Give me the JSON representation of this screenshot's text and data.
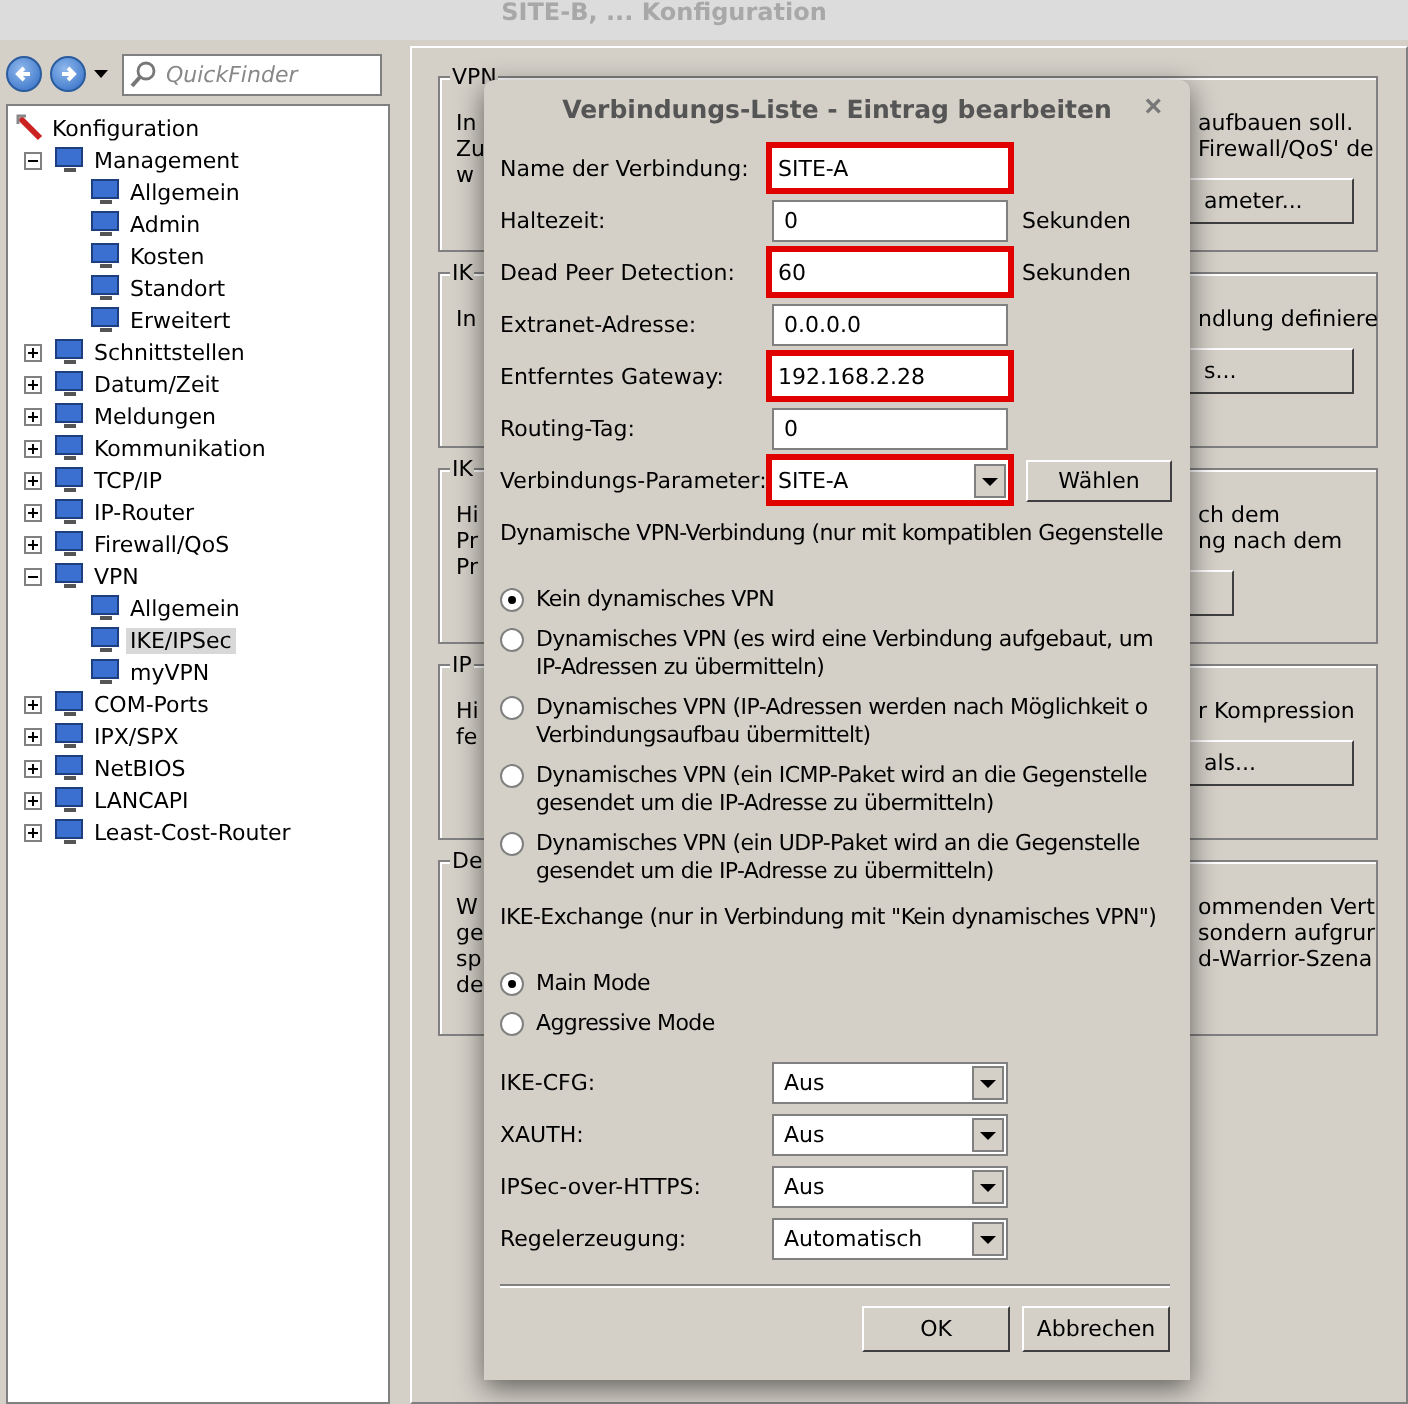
{
  "window": {
    "title": "SITE-B, ... Konfiguration"
  },
  "toolbar": {
    "search": {
      "placeholder": "QuickFinder"
    }
  },
  "tree": {
    "root": "Konfiguration",
    "items": [
      {
        "label": "Management",
        "expanded": true,
        "selected": false,
        "children": [
          {
            "label": "Allgemein",
            "selected": false
          },
          {
            "label": "Admin",
            "selected": false
          },
          {
            "label": "Kosten",
            "selected": false
          },
          {
            "label": "Standort",
            "selected": false
          },
          {
            "label": "Erweitert",
            "selected": false
          }
        ]
      },
      {
        "label": "Schnittstellen",
        "expanded": false,
        "selected": false
      },
      {
        "label": "Datum/Zeit",
        "expanded": false,
        "selected": false
      },
      {
        "label": "Meldungen",
        "expanded": false,
        "selected": false
      },
      {
        "label": "Kommunikation",
        "expanded": false,
        "selected": false
      },
      {
        "label": "TCP/IP",
        "expanded": false,
        "selected": false
      },
      {
        "label": "IP-Router",
        "expanded": false,
        "selected": false
      },
      {
        "label": "Firewall/QoS",
        "expanded": false,
        "selected": false
      },
      {
        "label": "VPN",
        "expanded": true,
        "selected": false,
        "children": [
          {
            "label": "Allgemein",
            "selected": false
          },
          {
            "label": "IKE/IPSec",
            "selected": true
          },
          {
            "label": "myVPN",
            "selected": false
          }
        ]
      },
      {
        "label": "COM-Ports",
        "expanded": false,
        "selected": false
      },
      {
        "label": "IPX/SPX",
        "expanded": false,
        "selected": false
      },
      {
        "label": "NetBIOS",
        "expanded": false,
        "selected": false
      },
      {
        "label": "LANCAPI",
        "expanded": false,
        "selected": false
      },
      {
        "label": "Least-Cost-Router",
        "expanded": false,
        "selected": false
      }
    ]
  },
  "groups": [
    {
      "title": "VPN",
      "left_lines": [
        "In",
        "Zu",
        "w"
      ],
      "right_lines": [
        "aufbauen soll.",
        "Firewall/QoS' de"
      ],
      "button": {
        "kind": "labeled",
        "label": "ameter..."
      }
    },
    {
      "title": "IK",
      "left_lines": [
        "In"
      ],
      "right_lines": [
        "ndlung definiere"
      ],
      "button": {
        "kind": "labeled",
        "label": "s..."
      }
    },
    {
      "title": "IK",
      "left_lines": [
        "Hi",
        "Pr",
        "Pr"
      ],
      "right_lines": [
        "ch dem",
        "ng nach dem"
      ],
      "button": {
        "kind": "blank"
      }
    },
    {
      "title": "IP",
      "left_lines": [
        "Hi",
        "fe"
      ],
      "right_lines": [
        "r Kompression"
      ],
      "button": {
        "kind": "labeled",
        "label": "als..."
      }
    },
    {
      "title": "De",
      "left_lines": [
        "W",
        "ge",
        "sp",
        "de"
      ],
      "right_lines": [
        "ommenden Vert",
        "sondern aufgrur",
        "d-Warrior-Szena"
      ]
    }
  ],
  "dialog": {
    "title": "Verbindungs-Liste - Eintrag bearbeiten",
    "close": "×",
    "fields": [
      {
        "kind": "text",
        "label": "Name der Verbindung:",
        "value": "SITE-A",
        "highlighted": true
      },
      {
        "kind": "text",
        "label": "Haltezeit:",
        "value": "0",
        "unit": "Sekunden",
        "highlighted": false
      },
      {
        "kind": "text",
        "label": "Dead Peer Detection:",
        "value": "60",
        "unit": "Sekunden",
        "highlighted": true
      },
      {
        "kind": "text",
        "label": "Extranet-Adresse:",
        "value": "0.0.0.0",
        "highlighted": false
      },
      {
        "kind": "text",
        "label": "Entferntes Gateway:",
        "value": "192.168.2.28",
        "highlighted": true
      },
      {
        "kind": "text",
        "label": "Routing-Tag:",
        "value": "0",
        "highlighted": false
      },
      {
        "kind": "select",
        "label": "Verbindungs-Parameter:",
        "value": "SITE-A",
        "highlighted": true,
        "button": "Wählen"
      }
    ],
    "dynamic_heading": "Dynamische VPN-Verbindung (nur mit kompatiblen Gegenstelle",
    "dynamic_options": [
      {
        "label": "Kein dynamisches VPN",
        "selected": true
      },
      {
        "label": "Dynamisches VPN (es wird eine Verbindung aufgebaut, um IP-Adressen zu übermitteln)",
        "selected": false
      },
      {
        "label": "Dynamisches VPN (IP-Adressen werden nach Möglichkeit o Verbindungsaufbau übermittelt)",
        "selected": false
      },
      {
        "label": "Dynamisches VPN (ein ICMP-Paket wird an die Gegenstelle gesendet um die IP-Adresse zu übermitteln)",
        "selected": false
      },
      {
        "label": "Dynamisches VPN (ein UDP-Paket wird an die Gegenstelle gesendet um die IP-Adresse zu übermitteln)",
        "selected": false
      }
    ],
    "exchange_heading": "IKE-Exchange (nur in Verbindung mit \"Kein dynamisches VPN\")",
    "exchange_options": [
      {
        "label": "Main Mode",
        "selected": true
      },
      {
        "label": "Aggressive Mode",
        "selected": false
      }
    ],
    "selects": [
      {
        "label": "IKE-CFG:",
        "value": "Aus"
      },
      {
        "label": "XAUTH:",
        "value": "Aus"
      },
      {
        "label": "IPSec-over-HTTPS:",
        "value": "Aus"
      },
      {
        "label": "Regelerzeugung:",
        "value": "Automatisch"
      }
    ],
    "buttons": [
      "OK",
      "Abbrechen"
    ]
  }
}
